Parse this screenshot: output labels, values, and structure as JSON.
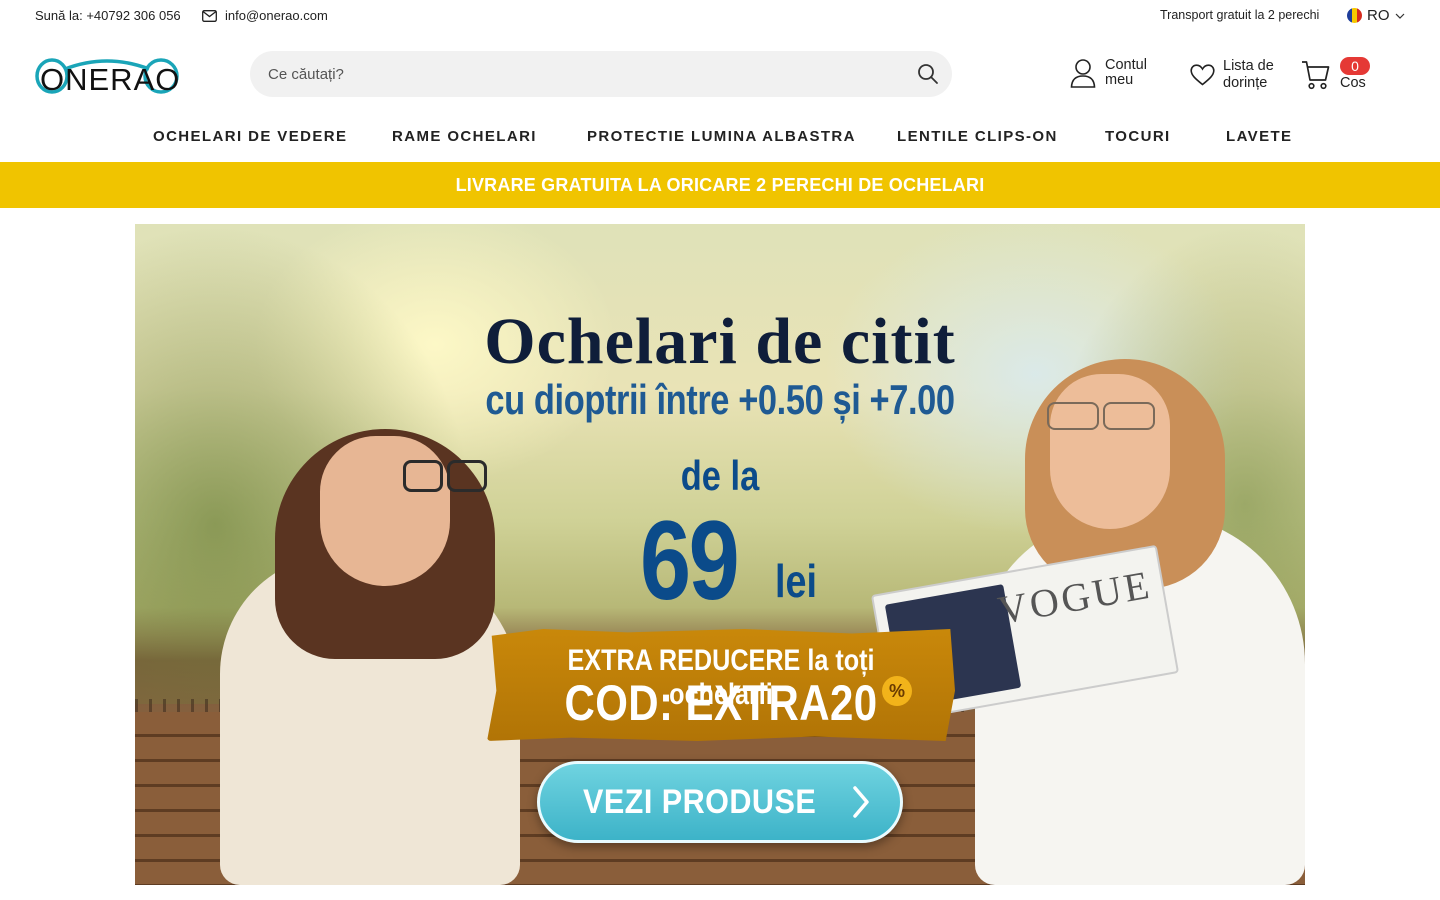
{
  "topbar": {
    "phone": "Sună la: +40792 306 056",
    "email": "info@onerao.com",
    "shipping": "Transport gratuit la 2 perechi",
    "language": "RO"
  },
  "header": {
    "logo_text": "ONERAO",
    "search_placeholder": "Ce căutați?",
    "account_label": "Contul meu",
    "wishlist_label": "Lista de dorințe",
    "cart_label": "Cos",
    "cart_count": "0"
  },
  "nav": {
    "items": [
      {
        "label": "OCHELARI DE VEDERE"
      },
      {
        "label": "RAME OCHELARI"
      },
      {
        "label": "PROTECTIE LUMINA ALBASTRA"
      },
      {
        "label": "LENTILE CLIPS-ON"
      },
      {
        "label": "TOCURI"
      },
      {
        "label": "LAVETE"
      }
    ]
  },
  "promo_bar": {
    "text": "LIVRARE GRATUITA LA ORICARE 2 PERECHI DE OCHELARI",
    "color": "#f0c400"
  },
  "hero": {
    "title": "Ochelari de citit",
    "subtitle": "cu dioptrii între +0.50 și +7.00",
    "from_label": "de la",
    "price": "69",
    "currency": "lei",
    "extra_line": "EXTRA REDUCERE la toți ochelarii",
    "code_line": "COD: EXTRA20",
    "percent_badge": "%",
    "magazine_title": "VOGUE",
    "cta_label": "VEZI PRODUSE"
  },
  "colors": {
    "accent_dark": "#0f1e3a",
    "price_blue": "#0b4b8a",
    "badge_red": "#e53935",
    "cta_teal": "#3db3c8",
    "logo_teal": "#1aa5b8"
  }
}
